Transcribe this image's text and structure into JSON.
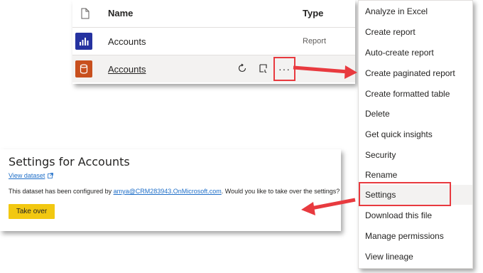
{
  "list": {
    "header": {
      "name": "Name",
      "type": "Type"
    },
    "rows": [
      {
        "name": "Accounts",
        "type": "Report",
        "icon": "report-icon"
      },
      {
        "name": "Accounts",
        "type": "",
        "icon": "dataset-icon",
        "more": "···"
      }
    ]
  },
  "menu": {
    "items": [
      "Analyze in Excel",
      "Create report",
      "Auto-create report",
      "Create paginated report",
      "Create formatted table",
      "Delete",
      "Get quick insights",
      "Security",
      "Rename",
      "Settings",
      "Download this file",
      "Manage permissions",
      "View lineage"
    ],
    "highlighted": "Settings"
  },
  "settings": {
    "title": "Settings for Accounts",
    "view_dataset": "View dataset",
    "config_prefix": "This dataset has been configured by ",
    "config_user": "amya@CRM283943.OnMicrosoft.com",
    "config_suffix": ". Would you like to take over the settings?",
    "take_over": "Take over"
  },
  "colors": {
    "accent_red": "#e83a3f",
    "take_over_yellow": "#f2c811",
    "report_icon_bg": "#2532a0",
    "dataset_icon_bg": "#c8501e",
    "link_blue": "#1e6ec8"
  }
}
